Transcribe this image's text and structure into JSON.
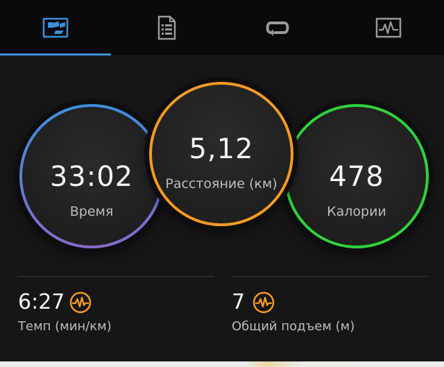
{
  "tabs": [
    {
      "name": "summary",
      "active": true,
      "icon": "flag-icon"
    },
    {
      "name": "details",
      "active": false,
      "icon": "document-icon"
    },
    {
      "name": "laps",
      "active": false,
      "icon": "loop-icon"
    },
    {
      "name": "charts",
      "active": false,
      "icon": "graph-icon"
    }
  ],
  "metrics": {
    "time": {
      "value": "33:02",
      "label": "Время",
      "ring_color": "#3f8ee0"
    },
    "distance": {
      "value": "5,12",
      "label": "Расстояние (км)",
      "ring_color": "#f59a23"
    },
    "calories": {
      "value": "478",
      "label": "Калории",
      "ring_color": "#2fd23c"
    }
  },
  "stats": {
    "pace": {
      "value": "6:27",
      "label": "Темп (мин/км)",
      "icon": "pulse-icon"
    },
    "ascent": {
      "value": "7",
      "label": "Общий подъем (м)",
      "icon": "pulse-icon"
    }
  },
  "colors": {
    "accent_tab": "#3b8fd6",
    "icon_orange": "#f59a23"
  }
}
